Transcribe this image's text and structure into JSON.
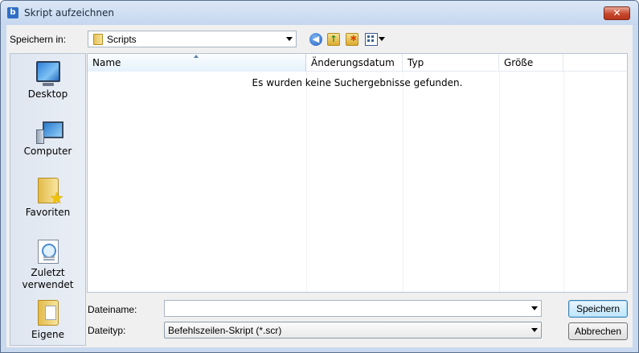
{
  "window": {
    "title": "Skript aufzeichnen",
    "close_label": "✕"
  },
  "toolbar": {
    "lookin_label": "Speichern in:",
    "lookin_value": "Scripts",
    "icons": [
      "back-icon",
      "up-folder-icon",
      "new-folder-icon",
      "view-menu-icon"
    ]
  },
  "places": [
    {
      "label": "Desktop",
      "icon": "desktop-icon"
    },
    {
      "label": "Computer",
      "icon": "computer-icon"
    },
    {
      "label": "Favoriten",
      "icon": "favorites-icon"
    },
    {
      "label": "Zuletzt verwendet",
      "icon": "recent-icon"
    },
    {
      "label": "Eigene",
      "icon": "documents-icon"
    }
  ],
  "filelist": {
    "columns": [
      "Name",
      "Änderungsdatum",
      "Typ",
      "Größe"
    ],
    "empty_message": "Es wurden keine Suchergebnisse gefunden."
  },
  "form": {
    "filename_label": "Dateiname:",
    "filename_value": "",
    "filetype_label": "Dateityp:",
    "filetype_value": "Befehlszeilen-Skript (*.scr)"
  },
  "buttons": {
    "save": "Speichern",
    "cancel": "Abbrechen"
  },
  "colors": {
    "title_bg": "#c9d9ee",
    "accent": "#3c7fb1",
    "close": "#c7472c"
  }
}
